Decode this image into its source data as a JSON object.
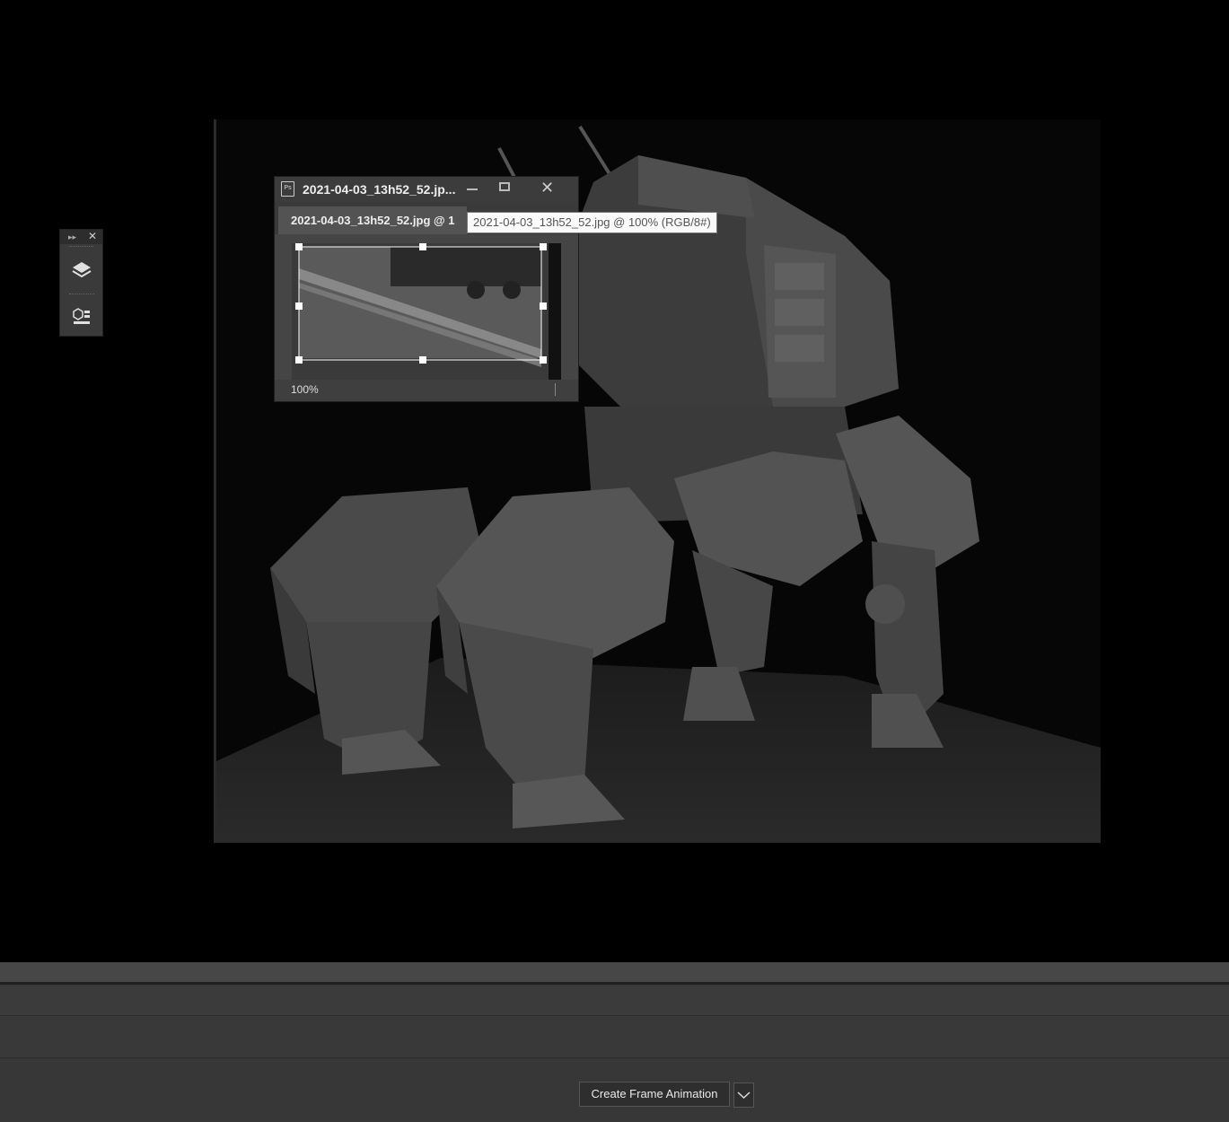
{
  "document": {
    "title": "2021-04-03_13h52_52.jp...",
    "tab_label": "2021-04-03_13h52_52.jpg @ 1",
    "tooltip": "2021-04-03_13h52_52.jpg @ 100% (RGB/8#)",
    "zoom": "100%",
    "app_icon": "Ps"
  },
  "tool_panel": {
    "collapse_glyph": "▸▸",
    "close_glyph": "✕",
    "tools": [
      {
        "icon": "layers-icon"
      },
      {
        "icon": "3d-properties-icon"
      }
    ]
  },
  "window_controls": {
    "close_glyph": "✕"
  },
  "timeline": {
    "create_button": "Create Frame Animation",
    "dropdown_icon": "chevron-down-icon"
  }
}
